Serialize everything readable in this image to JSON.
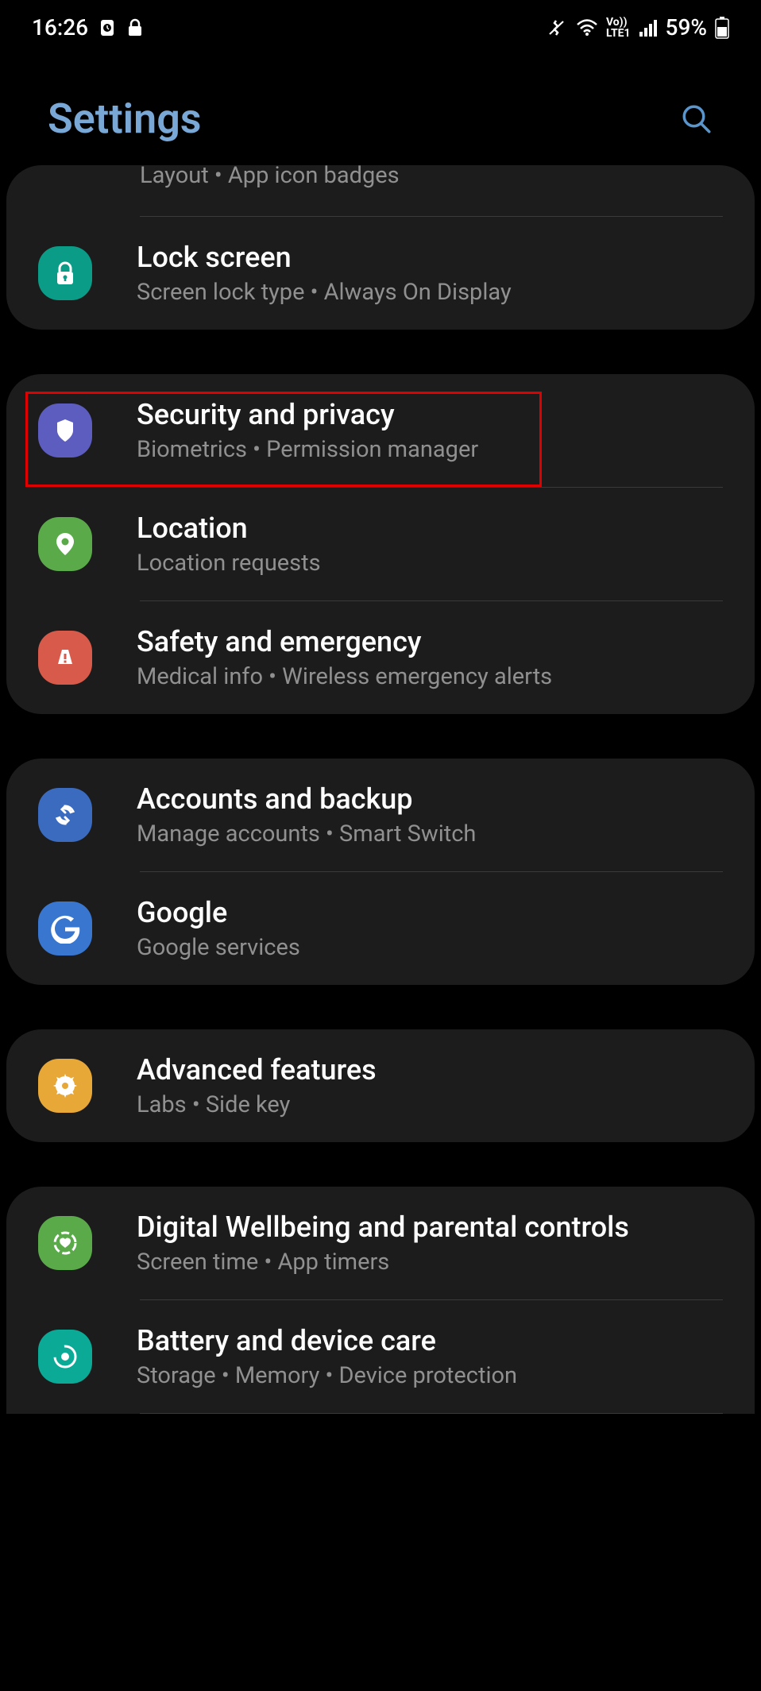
{
  "status": {
    "time": "16:26",
    "battery": "59%",
    "network_label": "LTE1"
  },
  "header": {
    "title": "Settings"
  },
  "partial_top": {
    "subtitle": "Layout  •  App icon badges"
  },
  "items": {
    "lock_screen": {
      "title": "Lock screen",
      "subtitle": "Screen lock type  •  Always On Display"
    },
    "security": {
      "title": "Security and privacy",
      "subtitle": "Biometrics  •  Permission manager"
    },
    "location": {
      "title": "Location",
      "subtitle": "Location requests"
    },
    "safety": {
      "title": "Safety and emergency",
      "subtitle": "Medical info  •  Wireless emergency alerts"
    },
    "accounts": {
      "title": "Accounts and backup",
      "subtitle": "Manage accounts  •  Smart Switch"
    },
    "google": {
      "title": "Google",
      "subtitle": "Google services"
    },
    "advanced": {
      "title": "Advanced features",
      "subtitle": "Labs  •  Side key"
    },
    "wellbeing": {
      "title": "Digital Wellbeing and parental controls",
      "subtitle": "Screen time  •  App timers"
    },
    "battery": {
      "title": "Battery and device care",
      "subtitle": "Storage  •  Memory  •  Device protection"
    }
  }
}
